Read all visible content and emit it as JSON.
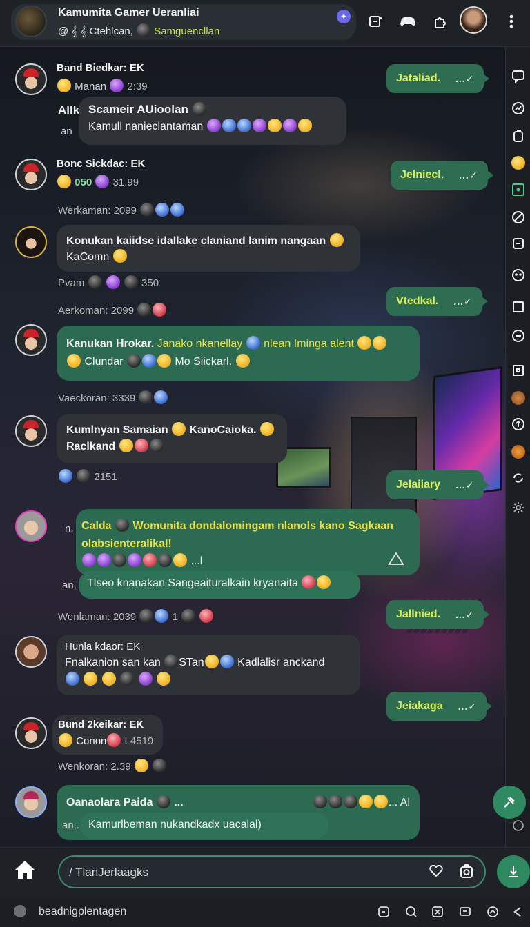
{
  "header": {
    "title": "Kamumita Gamer Ueranliai",
    "subtitle_main": "Ctehlcan,",
    "subtitle_highlight": "Samguencllan",
    "badge_icon": "sparkle-icon"
  },
  "messages": [
    {
      "sender": "Band Biedkar: EK",
      "meta_a": "Manan",
      "meta_b": "2:39",
      "quote_prefix": "Allk",
      "quote_title": "Scameir AUioolan",
      "quote_prefix2": "an",
      "quote_text": "Kamull nanieclantaman"
    },
    {
      "sender": "Bonc Sickdac: EK",
      "meta_a": "050",
      "meta_b": "31.99",
      "reactions": "Werkaman: 2099"
    },
    {
      "text": "Konukan kaiidse idallake claniand lanim nangaan",
      "sub": "KaComn",
      "meta_a": "Pvam",
      "meta_b": "350",
      "reactions": "Aerkoman: 2099"
    },
    {
      "title": "Kanukan Hrokar.",
      "text": "Janako nkanellay",
      "text2": "nlean Iminga alent",
      "sub": "Clundar",
      "sub2": "Mo Siickarl.",
      "reactions": "Vaeckoran: 3339"
    },
    {
      "title": "Kumlnyan Samaian",
      "text": "KanoCaioka.",
      "sub": "Raclkand",
      "meta_b": "2151"
    },
    {
      "prefix": "n,",
      "title": "Calda",
      "text": "Womunita dondalomingam nlanols kano Sagkaan olabsienteralikal!",
      "tail": "...l",
      "prefix2": "an,",
      "quote_text": "Tlseo knanakan Sangeaituralkain kryanaita",
      "reactions": "Wenlaman: 2039",
      "reactions_count": "1"
    },
    {
      "sender": "Hunla kdaor: EK",
      "text": "Fnalkanion san kan",
      "text2": "STan",
      "text3": "Kadlalisr anckand"
    },
    {
      "sender": "Bund 2keikar: EK",
      "meta_a": "Conon",
      "meta_b": "L4519",
      "reactions": "Wenkoran: 2.39"
    },
    {
      "title": "Oanaolara Paida",
      "tail": "...",
      "tail2": "... Al",
      "prefix2": "an,.",
      "quote_text": "Kamurlbeman nukandkadx uacalal)"
    }
  ],
  "outgoing": [
    "Jataliad.",
    "Jelniecl.",
    "Vtedkal.",
    "Jelaiiary",
    "Jallnied.",
    "Jeiakaga"
  ],
  "ticks": "...✓",
  "composer": {
    "placeholder": "/ TlanJerlaagks"
  },
  "status_bar": {
    "text": "beadnigplentagen"
  }
}
